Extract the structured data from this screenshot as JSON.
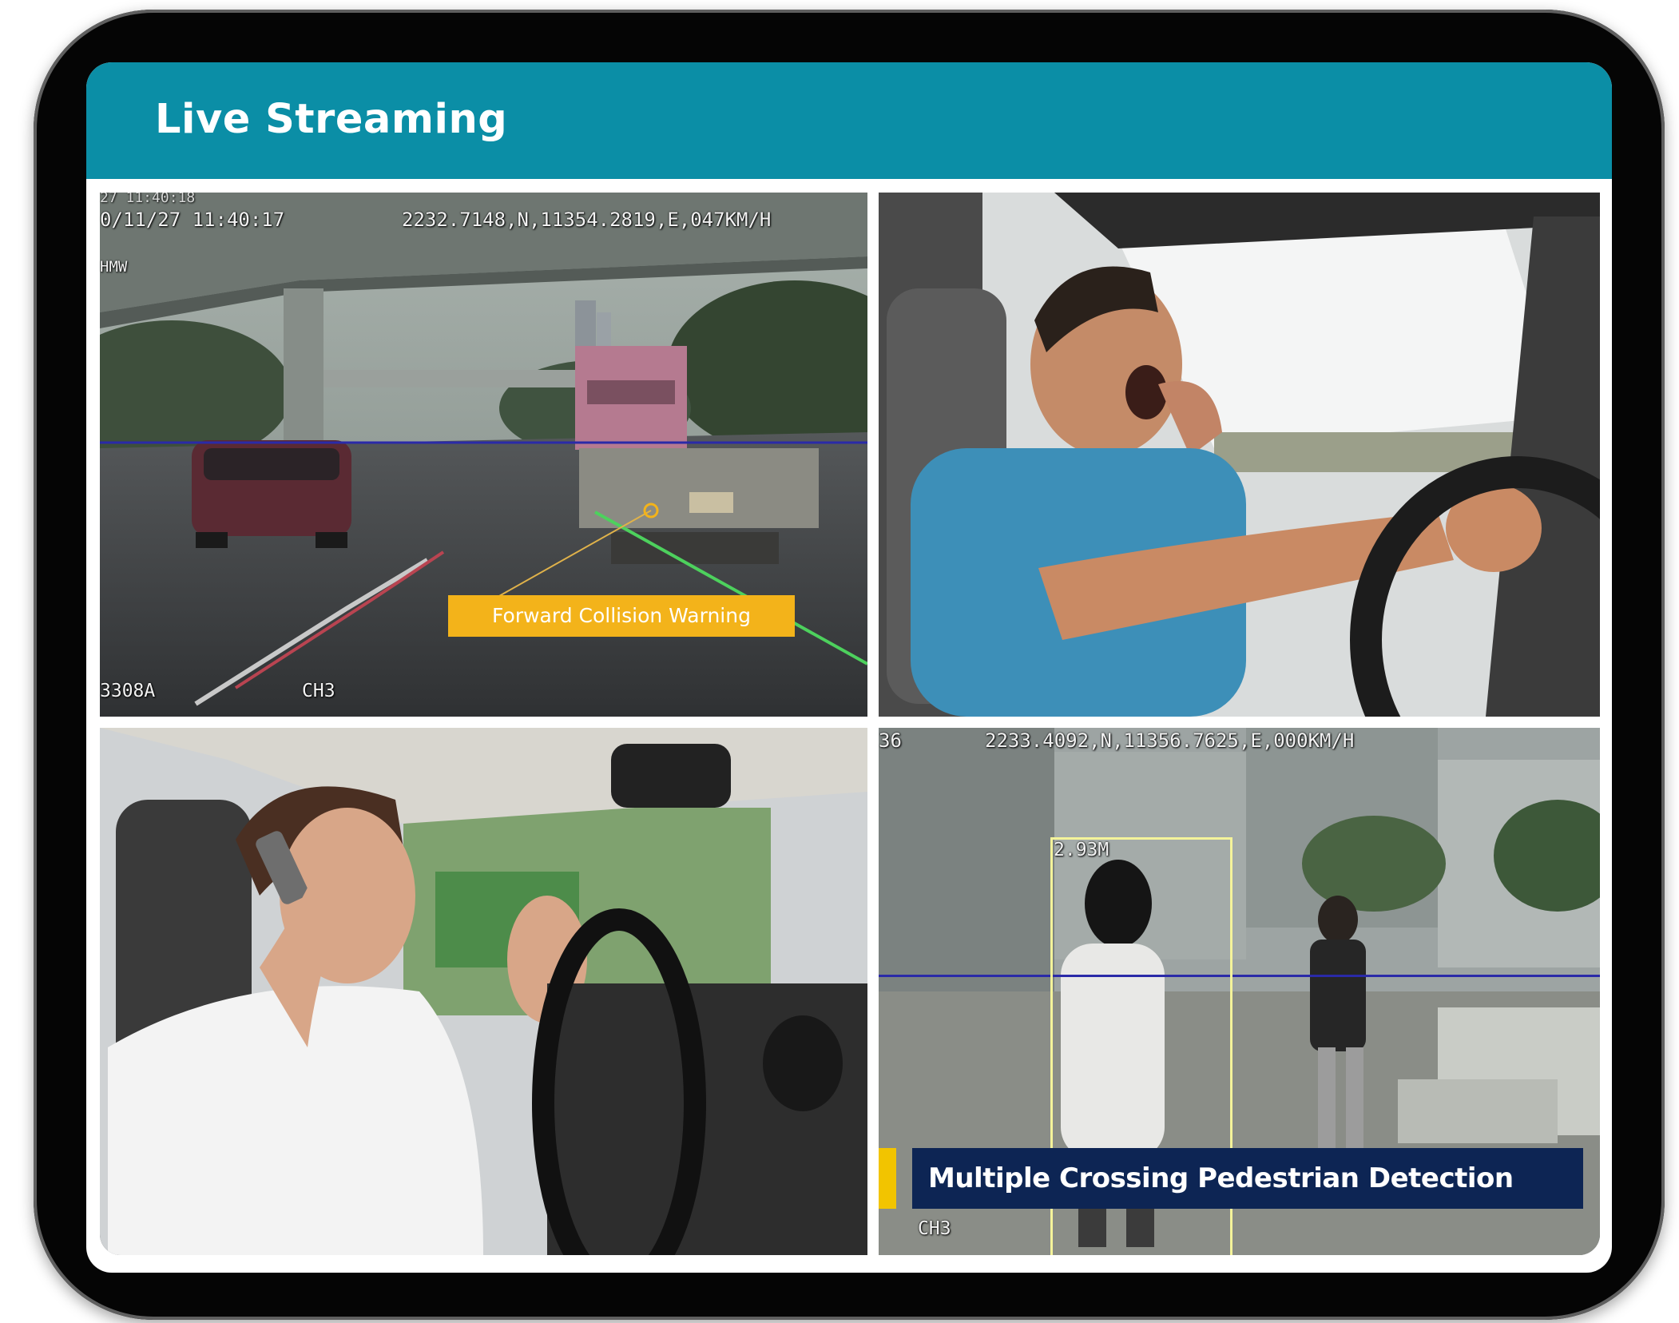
{
  "app": {
    "title": "Live Streaming"
  },
  "colors": {
    "header": "#0b8ea6",
    "warning_badge": "#f3b31a",
    "detection_badge": "#0d2554",
    "detection_box": "#f4f39a"
  },
  "feeds": [
    {
      "osd_timestamp_top": "27 11:40:18",
      "osd_timestamp": "0/11/27 11:40:17",
      "osd_gps": "2232.7148,N,11354.2819,E,047KM/H",
      "osd_mode": "HMW",
      "osd_device": "3308A",
      "osd_channel": "CH3",
      "alert": "Forward Collision Warning"
    },
    {
      "description_icon": "drowsy-driver-icon"
    },
    {
      "description_icon": "phone-distraction-icon"
    },
    {
      "osd_index": "36",
      "osd_gps": "2233.4092,N,11356.7625,E,000KM/H",
      "distance": "2.93M",
      "alert": "Multiple Crossing Pedestrian Detection",
      "osd_channel": "CH3"
    }
  ]
}
